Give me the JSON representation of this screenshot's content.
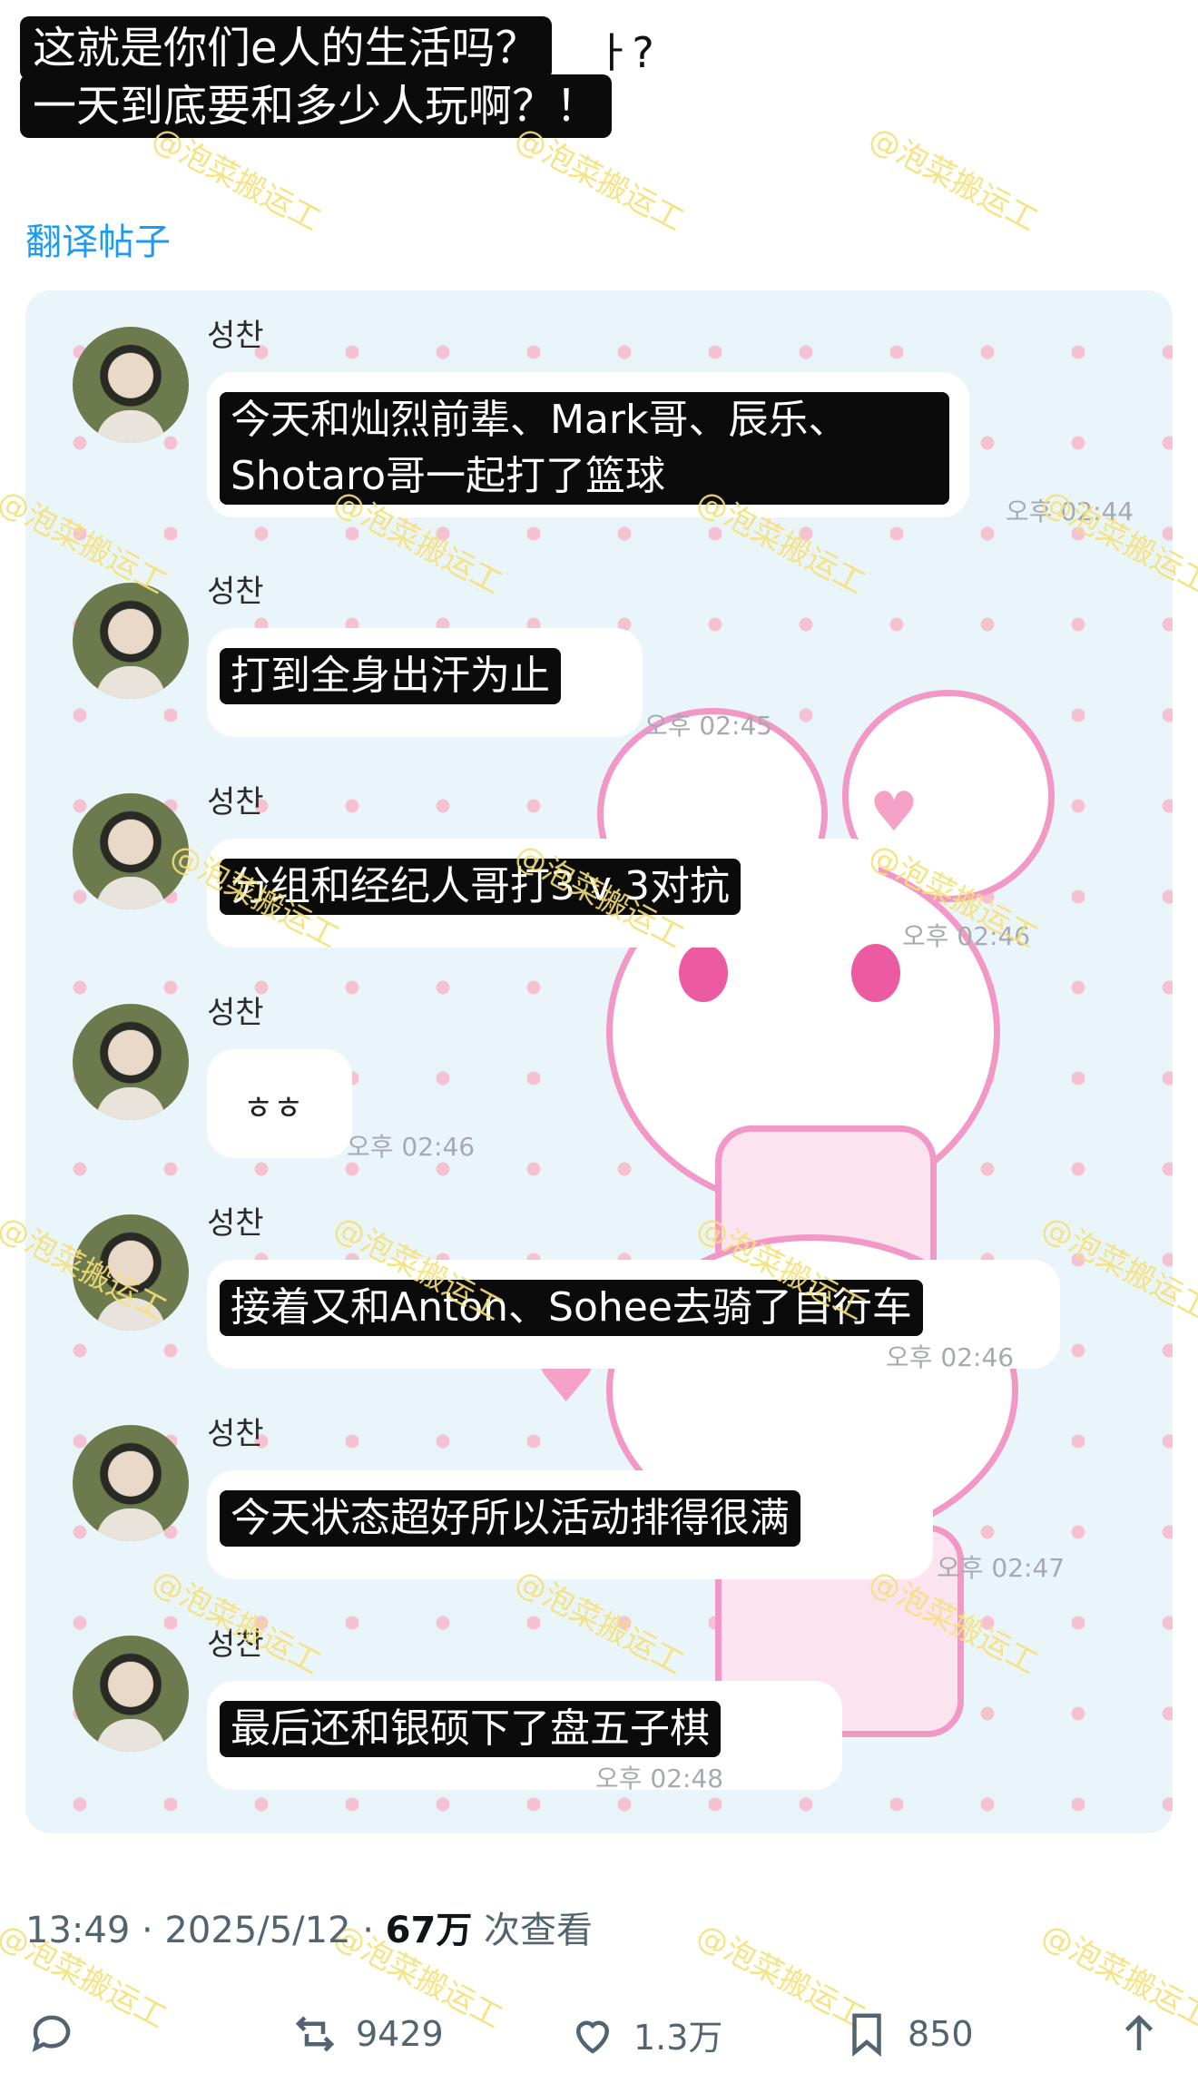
{
  "caption": {
    "line1": "这就是你们e人的生活吗？",
    "line1_tail": "ㅏ?",
    "line2": "一天到底要和多少人玩啊？！"
  },
  "translate_link": "翻译帖子",
  "chat": {
    "messages": [
      {
        "sender": "성찬",
        "text": "今天和灿烈前辈、Mark哥、辰乐、Shotaro哥一起打了篮球",
        "time": "오후 02:44"
      },
      {
        "sender": "성찬",
        "text": "打到全身出汗为止",
        "time": "오후 02:45"
      },
      {
        "sender": "성찬",
        "text": "分组和经纪人哥打3 v 3对抗",
        "time": "오후 02:46"
      },
      {
        "sender": "성찬",
        "text": "ㅎㅎ",
        "time": "오후 02:46"
      },
      {
        "sender": "성찬",
        "text": "接着又和Anton、Sohee去骑了自行车",
        "time": "오후 02:46"
      },
      {
        "sender": "성찬",
        "text": "今天状态超好所以活动排得很满",
        "time": "오후 02:47"
      },
      {
        "sender": "성찬",
        "text": "最后还和银硕下了盘五子棋",
        "time": "오후 02:48"
      }
    ]
  },
  "watermark_text": "@泡菜搬运工",
  "meta": {
    "time_date": "13:49 · 2025/5/12 · ",
    "views": "67万",
    "views_label": " 次查看"
  },
  "actions": {
    "retweets": "9429",
    "likes": "1.3万",
    "bookmarks": "850"
  },
  "icons": [
    "reply-icon",
    "retweet-icon",
    "like-icon",
    "bookmark-icon",
    "share-icon"
  ],
  "colors": {
    "link": "#1d9bf0",
    "watermark": "#f6e07a",
    "card_bg": "#eaf5fa",
    "dots": "#f4c2d3"
  }
}
